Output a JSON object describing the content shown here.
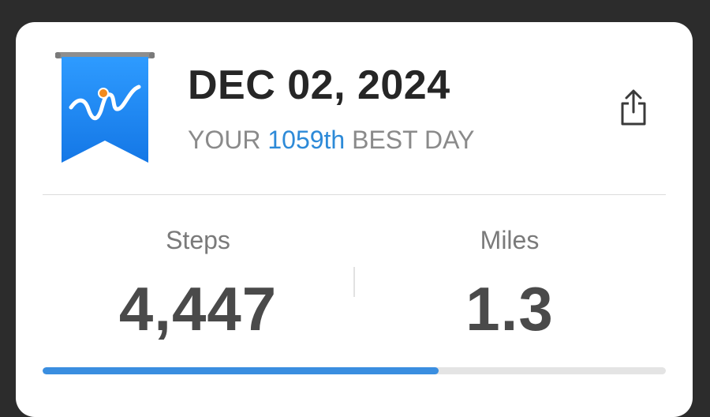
{
  "header": {
    "date": "DEC 02, 2024",
    "subtitle_prefix": "YOUR",
    "rank": "1059th",
    "subtitle_suffix": "BEST DAY"
  },
  "icons": {
    "badge": "ribbon-chart-icon",
    "share": "share-icon"
  },
  "stats": {
    "steps_label": "Steps",
    "steps_value": "4,447",
    "miles_label": "Miles",
    "miles_value": "1.3"
  },
  "progress": {
    "fraction": 0.635
  },
  "colors": {
    "accent": "#2d8ad8",
    "ribbon": "#1f86ee",
    "progress": "#3a8ee0",
    "dot": "#f28b1e"
  }
}
